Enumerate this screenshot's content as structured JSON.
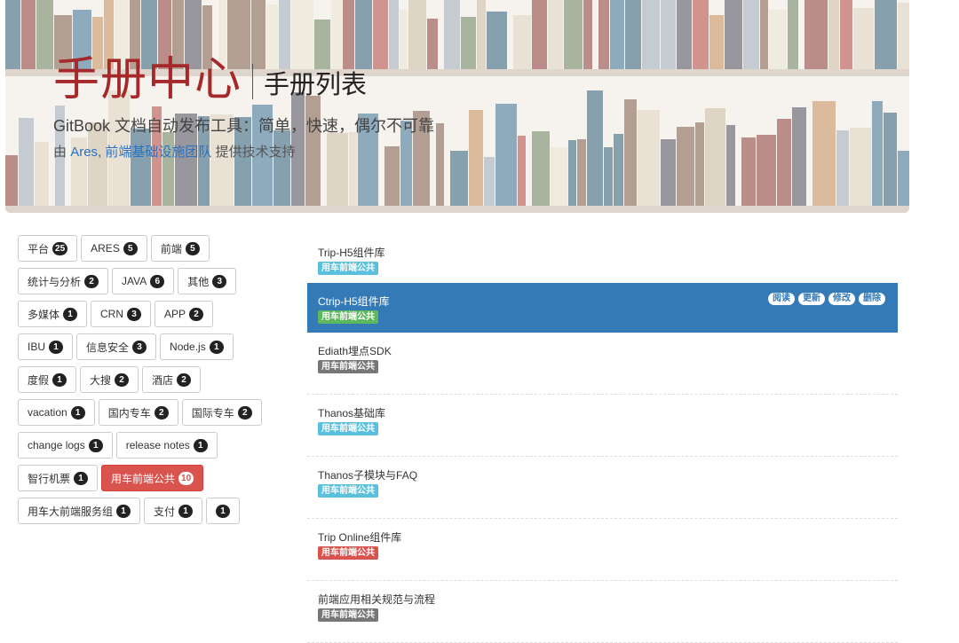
{
  "header": {
    "title": "手册中心",
    "subtitle": "手册列表",
    "tagline": "GitBook 文档自动发布工具：简单，快速，偶尔不可靠",
    "credit_prefix": "由",
    "credit_link1": "Ares",
    "credit_comma": ",",
    "credit_link2": "前端基础设施团队",
    "credit_suffix": "提供技术支持"
  },
  "tags": [
    [
      {
        "label": "平台",
        "count": "25"
      },
      {
        "label": "ARES",
        "count": "5"
      },
      {
        "label": "前端",
        "count": "5"
      }
    ],
    [
      {
        "label": "统计与分析",
        "count": "2"
      },
      {
        "label": "JAVA",
        "count": "6"
      },
      {
        "label": "其他",
        "count": "3"
      }
    ],
    [
      {
        "label": "多媒体",
        "count": "1"
      },
      {
        "label": "CRN",
        "count": "3"
      },
      {
        "label": "APP",
        "count": "2"
      }
    ],
    [
      {
        "label": "IBU",
        "count": "1"
      },
      {
        "label": "信息安全",
        "count": "3"
      },
      {
        "label": "Node.js",
        "count": "1"
      }
    ],
    [
      {
        "label": "度假",
        "count": "1"
      },
      {
        "label": "大搜",
        "count": "2"
      },
      {
        "label": "酒店",
        "count": "2"
      }
    ],
    [
      {
        "label": "vacation",
        "count": "1"
      },
      {
        "label": "国内专车",
        "count": "2"
      },
      {
        "label": "国际专车",
        "count": "2"
      }
    ],
    [
      {
        "label": "change logs",
        "count": "1"
      },
      {
        "label": "release notes",
        "count": "1"
      }
    ],
    [
      {
        "label": "智行机票",
        "count": "1"
      },
      {
        "label": "用车前端公共",
        "count": "10",
        "active": true
      }
    ],
    [
      {
        "label": "用车大前端服务组",
        "count": "1"
      },
      {
        "label": "支付",
        "count": "1"
      },
      {
        "label": "",
        "count": "1"
      }
    ]
  ],
  "manuals": [
    {
      "name": "Trip-H5组件库",
      "label": "用车前端公共",
      "label_class": "info"
    },
    {
      "name": "Ctrip-H5组件库",
      "label": "用车前端公共",
      "label_class": "success",
      "selected": true
    },
    {
      "name": "Ediath埋点SDK",
      "label": "用车前端公共",
      "label_class": "default"
    },
    {
      "name": "Thanos基础库",
      "label": "用车前端公共",
      "label_class": "info"
    },
    {
      "name": "Thanos子模块与FAQ",
      "label": "用车前端公共",
      "label_class": "info"
    },
    {
      "name": "Trip Online组件库",
      "label": "用车前端公共",
      "label_class": "danger"
    },
    {
      "name": "前端应用相关规范与流程",
      "label": "用车前端公共",
      "label_class": "default"
    }
  ],
  "actions": {
    "read": "阅读",
    "update": "更新",
    "edit": "修改",
    "delete": "删除"
  }
}
